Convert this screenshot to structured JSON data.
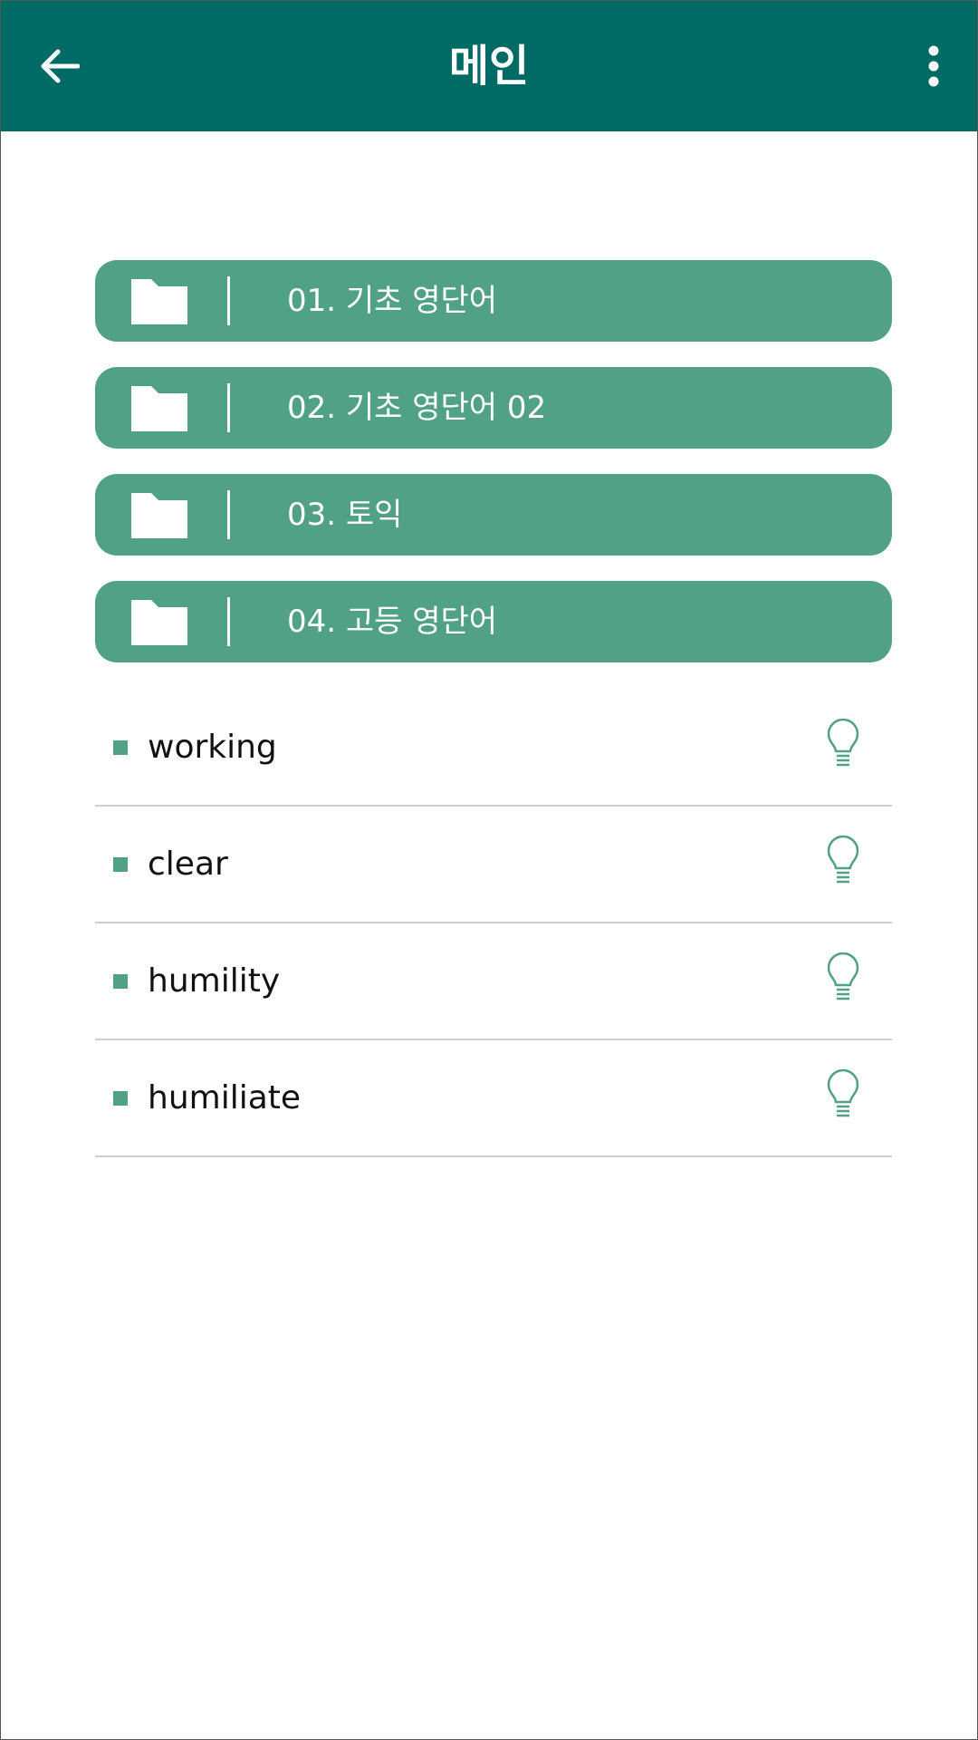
{
  "appbar": {
    "title": "메인",
    "back_icon": "arrow-left-icon",
    "menu_icon": "more-vertical-icon",
    "color": "#006A65"
  },
  "folders": [
    {
      "label": "01. 기초 영단어",
      "icon": "folder-icon"
    },
    {
      "label": "02. 기초 영단어 02",
      "icon": "folder-icon"
    },
    {
      "label": "03. 토익",
      "icon": "folder-icon"
    },
    {
      "label": "04. 고등 영단어",
      "icon": "folder-icon"
    }
  ],
  "folder_color": "#51A184",
  "words": [
    {
      "text": "working",
      "icon": "lightbulb-icon"
    },
    {
      "text": "clear",
      "icon": "lightbulb-icon"
    },
    {
      "text": "humility",
      "icon": "lightbulb-icon"
    },
    {
      "text": "humiliate",
      "icon": "lightbulb-icon"
    }
  ]
}
